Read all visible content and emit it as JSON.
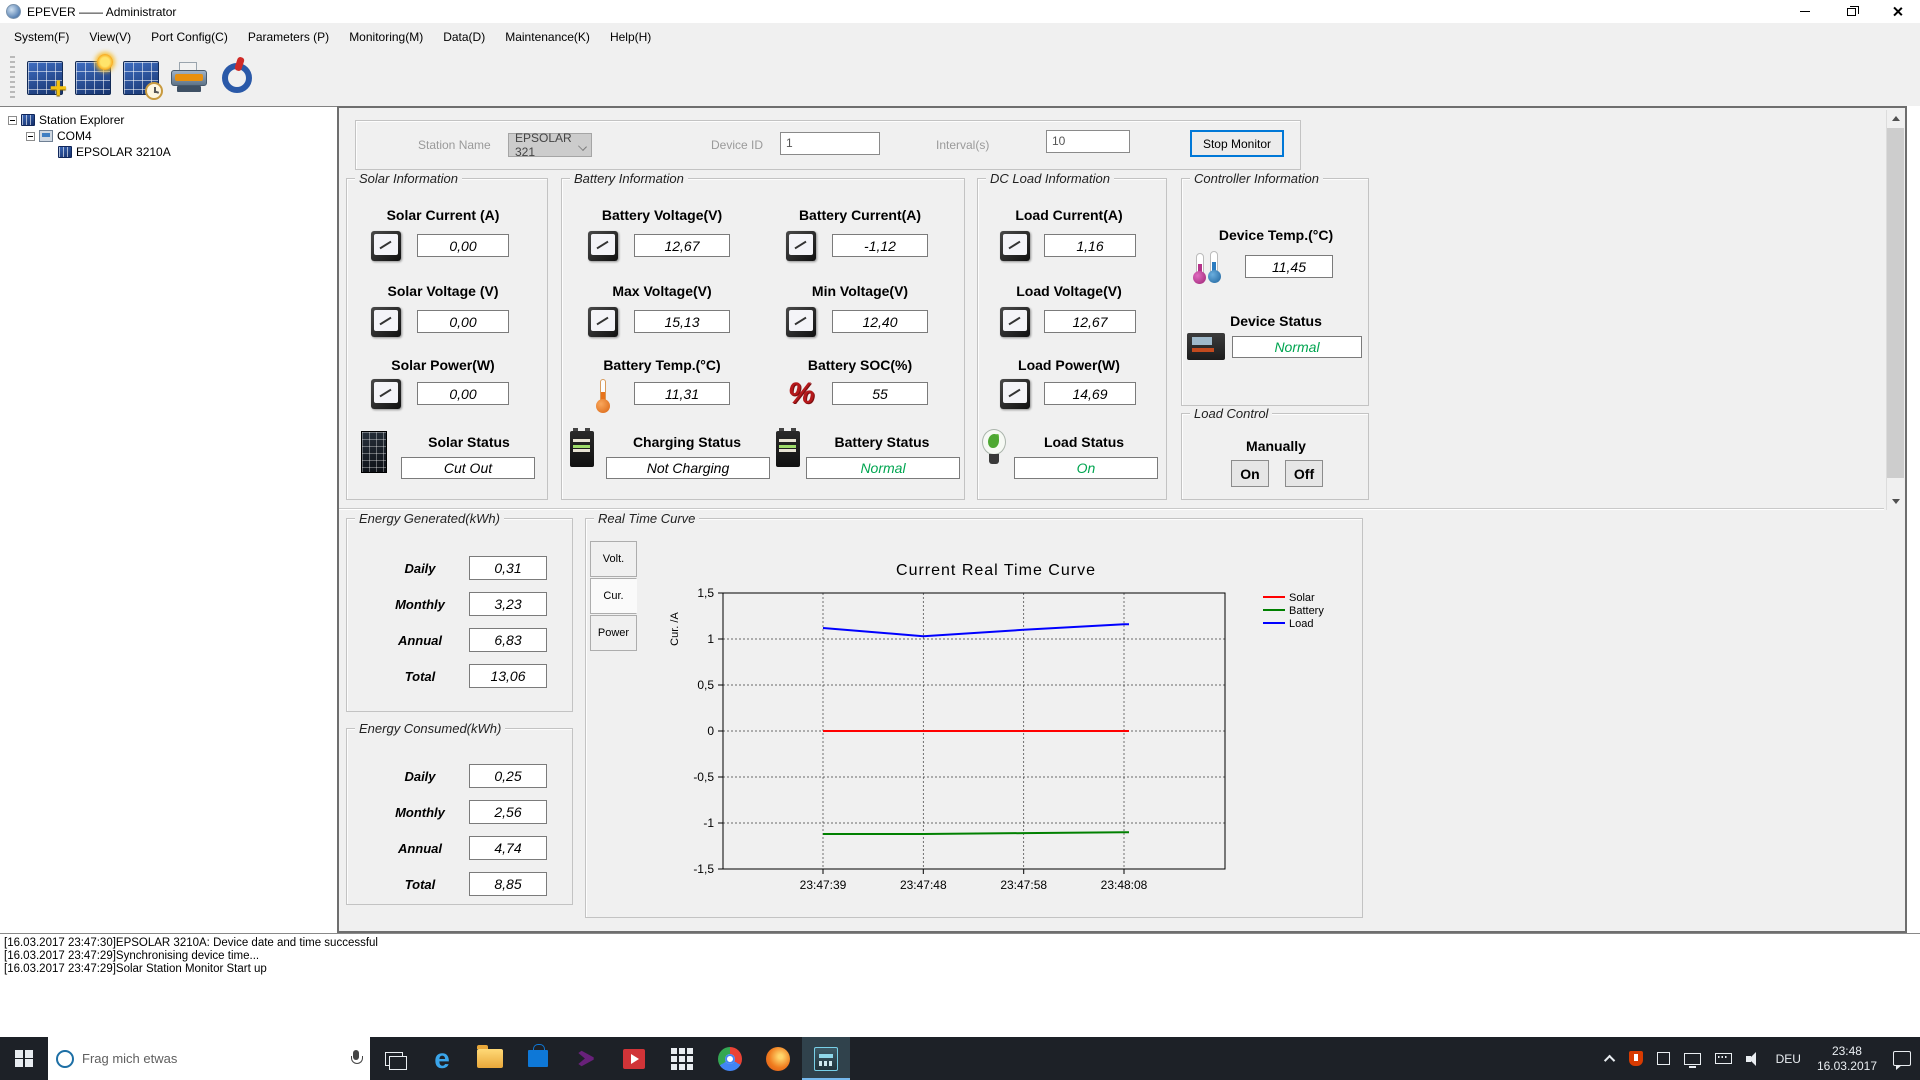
{
  "window": {
    "title": "EPEVER —— Administrator"
  },
  "menu": {
    "items": [
      "System(F)",
      "View(V)",
      "Port Config(C)",
      "Parameters (P)",
      "Monitoring(M)",
      "Data(D)",
      "Maintenance(K)",
      "Help(H)"
    ]
  },
  "toolbar": {
    "icons": [
      "add-station",
      "station-monitor",
      "device-time",
      "print",
      "power-exit"
    ]
  },
  "tree": {
    "root": "Station Explorer",
    "port": "COM4",
    "device": "EPSOLAR 3210A"
  },
  "form": {
    "station_name_label": "Station Name",
    "station_name_value": "EPSOLAR 321",
    "device_id_label": "Device ID",
    "device_id_value": "1",
    "interval_label": "Interval(s)",
    "interval_value": "10",
    "stop_button": "Stop Monitor"
  },
  "solar": {
    "title": "Solar Information",
    "fields": [
      {
        "label": "Solar Current (A)",
        "value": "0,00"
      },
      {
        "label": "Solar Voltage (V)",
        "value": "0,00"
      },
      {
        "label": "Solar Power(W)",
        "value": "0,00"
      }
    ],
    "status_label": "Solar Status",
    "status_value": "Cut Out"
  },
  "battery": {
    "title": "Battery Information",
    "col1": [
      {
        "label": "Battery Voltage(V)",
        "value": "12,67"
      },
      {
        "label": "Max Voltage(V)",
        "value": "15,13"
      },
      {
        "label": "Battery Temp.(°C)",
        "value": "11,31"
      }
    ],
    "col2": [
      {
        "label": "Battery Current(A)",
        "value": "-1,12"
      },
      {
        "label": "Min Voltage(V)",
        "value": "12,40"
      },
      {
        "label": "Battery SOC(%)",
        "value": "55"
      }
    ],
    "charging_status_label": "Charging Status",
    "charging_status_value": "Not Charging",
    "battery_status_label": "Battery Status",
    "battery_status_value": "Normal"
  },
  "dc_load": {
    "title": "DC Load Information",
    "fields": [
      {
        "label": "Load Current(A)",
        "value": "1,16"
      },
      {
        "label": "Load Voltage(V)",
        "value": "12,67"
      },
      {
        "label": "Load Power(W)",
        "value": "14,69"
      }
    ],
    "status_label": "Load Status",
    "status_value": "On"
  },
  "controller": {
    "title": "Controller Information",
    "temp_label": "Device Temp.(°C)",
    "temp_value": "11,45",
    "status_label": "Device Status",
    "status_value": "Normal"
  },
  "load_control": {
    "title": "Load Control",
    "manually_label": "Manually",
    "on_button": "On",
    "off_button": "Off"
  },
  "energy_generated": {
    "title": "Energy Generated(kWh)",
    "rows": [
      {
        "label": "Daily",
        "value": "0,31"
      },
      {
        "label": "Monthly",
        "value": "3,23"
      },
      {
        "label": "Annual",
        "value": "6,83"
      },
      {
        "label": "Total",
        "value": "13,06"
      }
    ]
  },
  "energy_consumed": {
    "title": "Energy Consumed(kWh)",
    "rows": [
      {
        "label": "Daily",
        "value": "0,25"
      },
      {
        "label": "Monthly",
        "value": "2,56"
      },
      {
        "label": "Annual",
        "value": "4,74"
      },
      {
        "label": "Total",
        "value": "8,85"
      }
    ]
  },
  "curve": {
    "title": "Real Time Curve",
    "tabs": [
      "Volt.",
      "Cur.",
      "Power"
    ]
  },
  "chart_data": {
    "type": "line",
    "title": "Current Real Time Curve",
    "ylabel": "Cur. /A",
    "ylim": [
      -1.5,
      1.5
    ],
    "ytick_values": [
      1.5,
      1,
      0.5,
      0,
      -0.5,
      -1,
      -1.5
    ],
    "ytick_labels": [
      "1,5",
      "1",
      "0,5",
      "0",
      "-0,5",
      "-1",
      "-1,5"
    ],
    "x_labels": [
      "23:47:39",
      "23:47:48",
      "23:47:58",
      "23:48:08"
    ],
    "grid": "dashed",
    "legend_position": "top-right",
    "series": [
      {
        "name": "Solar",
        "color": "#ff0000",
        "values": [
          0,
          0,
          0,
          0
        ]
      },
      {
        "name": "Battery",
        "color": "#008000",
        "values": [
          -1.12,
          -1.12,
          -1.11,
          -1.1
        ]
      },
      {
        "name": "Load",
        "color": "#0000ff",
        "values": [
          1.12,
          1.03,
          1.1,
          1.16
        ]
      }
    ]
  },
  "log": {
    "lines": [
      "[16.03.2017 23:47:30]EPSOLAR 3210A: Device date and time successful",
      "[16.03.2017 23:47:29]Synchronising device time...",
      "[16.03.2017 23:47:29]Solar Station Monitor Start up"
    ]
  },
  "taskbar": {
    "search_placeholder": "Frag mich etwas",
    "pinned_icons": [
      "edge",
      "file-explorer",
      "store",
      "visual-studio",
      "movies-tv",
      "app-grid",
      "chrome",
      "firefox",
      "epever-monitor"
    ],
    "active_icon": "epever-monitor",
    "tray_icons": [
      "chevron-up",
      "defender",
      "background-app",
      "display",
      "touch-keyboard",
      "volume"
    ],
    "language": "DEU",
    "time": "23:48",
    "date": "16.03.2017"
  },
  "colors": {
    "status_green": "#00A550",
    "accent_blue": "#0078d7"
  }
}
